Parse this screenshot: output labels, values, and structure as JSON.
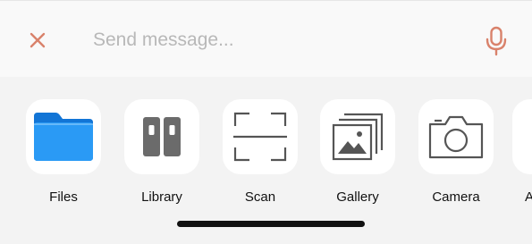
{
  "message_bar": {
    "placeholder": "Send message...",
    "value": "",
    "close_icon": "close-icon",
    "mic_icon": "microphone-icon"
  },
  "apps": [
    {
      "label": "Files",
      "icon": "folder-icon"
    },
    {
      "label": "Library",
      "icon": "library-icon"
    },
    {
      "label": "Scan",
      "icon": "scan-icon"
    },
    {
      "label": "Gallery",
      "icon": "gallery-icon"
    },
    {
      "label": "Camera",
      "icon": "camera-icon"
    },
    {
      "label": "A",
      "icon": ""
    }
  ],
  "colors": {
    "accent": "#d9826b",
    "folder": "#1e8ff0",
    "icon_gray": "#555555",
    "tray_bg": "#f3f3f3",
    "bar_bg": "#f9f9f9"
  }
}
